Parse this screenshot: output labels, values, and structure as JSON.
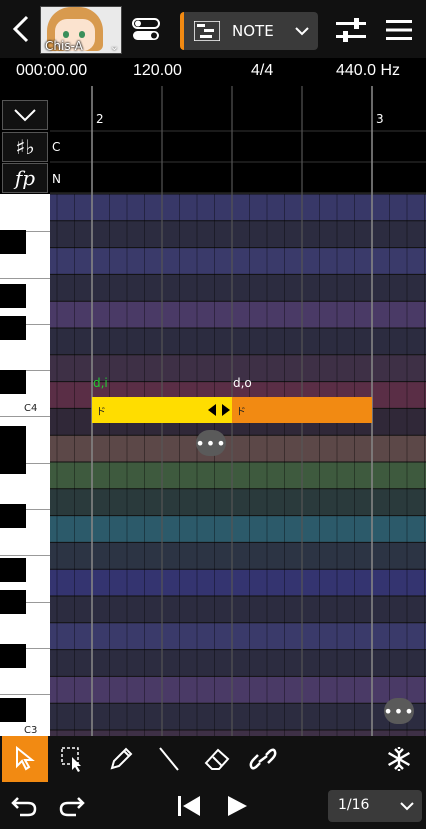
{
  "header": {
    "singer_name": "Chis-A",
    "track_mode": "NOTE"
  },
  "status": {
    "time": "000:00.00",
    "tempo": "120.00",
    "beat": "4/4",
    "pitch": "440.0 Hz"
  },
  "lanes": {
    "chord_label": "C",
    "dynamics_label": "N"
  },
  "ruler": {
    "measure_2": "2",
    "measure_3": "3"
  },
  "keys": {
    "c4": "C4",
    "c3": "C3"
  },
  "notes": [
    {
      "phoneme": "d,i",
      "lyric": "ド",
      "color": "#ffdd00"
    },
    {
      "phoneme": "d,o",
      "lyric": "ド",
      "color": "#f28a12"
    }
  ],
  "colors": {
    "accent": "#f28a12",
    "selected_note": "#ffdd00",
    "phoneme_selected": "#22cc33"
  },
  "toolbar": {
    "tools": [
      "select-arrow",
      "range-select",
      "pencil",
      "line",
      "eraser",
      "link",
      "freeze"
    ],
    "active_tool": "select-arrow"
  },
  "bottom": {
    "quantize": "1/16"
  }
}
